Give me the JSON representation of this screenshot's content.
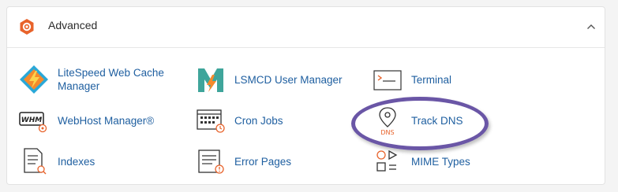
{
  "section": {
    "title": "Advanced",
    "icon": "gear-icon",
    "collapse_icon": "chevron-up-icon",
    "accent_color": "#e8632b",
    "link_color": "#1f5fa0",
    "highlight_color": "#6a56a6"
  },
  "items": [
    {
      "id": "litespeed",
      "label": "LiteSpeed Web Cache Manager",
      "icon": "litespeed-icon"
    },
    {
      "id": "lsmcd",
      "label": "LSMCD User Manager",
      "icon": "lsmcd-icon"
    },
    {
      "id": "terminal",
      "label": "Terminal",
      "icon": "terminal-icon",
      "highlighted": true
    },
    {
      "id": "whm",
      "label": "WebHost Manager®",
      "icon": "whm-icon",
      "icon_text": "WHM"
    },
    {
      "id": "cron",
      "label": "Cron Jobs",
      "icon": "cron-icon"
    },
    {
      "id": "trackdns",
      "label": "Track DNS",
      "icon": "track-dns-icon",
      "icon_text": "DNS"
    },
    {
      "id": "indexes",
      "label": "Indexes",
      "icon": "indexes-icon"
    },
    {
      "id": "errorpages",
      "label": "Error Pages",
      "icon": "error-pages-icon"
    },
    {
      "id": "mime",
      "label": "MIME Types",
      "icon": "mime-types-icon"
    }
  ]
}
